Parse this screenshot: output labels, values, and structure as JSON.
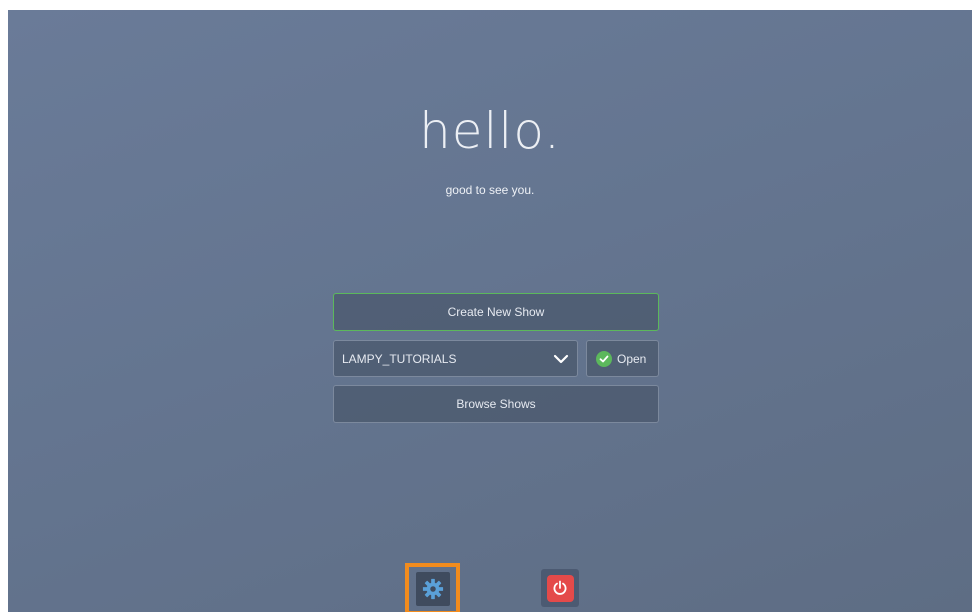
{
  "welcome": {
    "title": "hello.",
    "subtitle": "good to see you."
  },
  "actions": {
    "create_label": "Create New Show",
    "show_select_value": "LAMPY_TUTORIALS",
    "open_label": "Open",
    "browse_label": "Browse Shows"
  },
  "icons": {
    "dropdown": "chevron-down-icon",
    "open_status": "check-circle-icon",
    "settings": "gear-icon",
    "power": "power-icon"
  },
  "colors": {
    "background": "#647590",
    "accent_green": "#5cb85c",
    "highlight_orange": "#f28c1e",
    "power_red": "#e44a4a",
    "settings_gear": "#5aa0d8"
  }
}
